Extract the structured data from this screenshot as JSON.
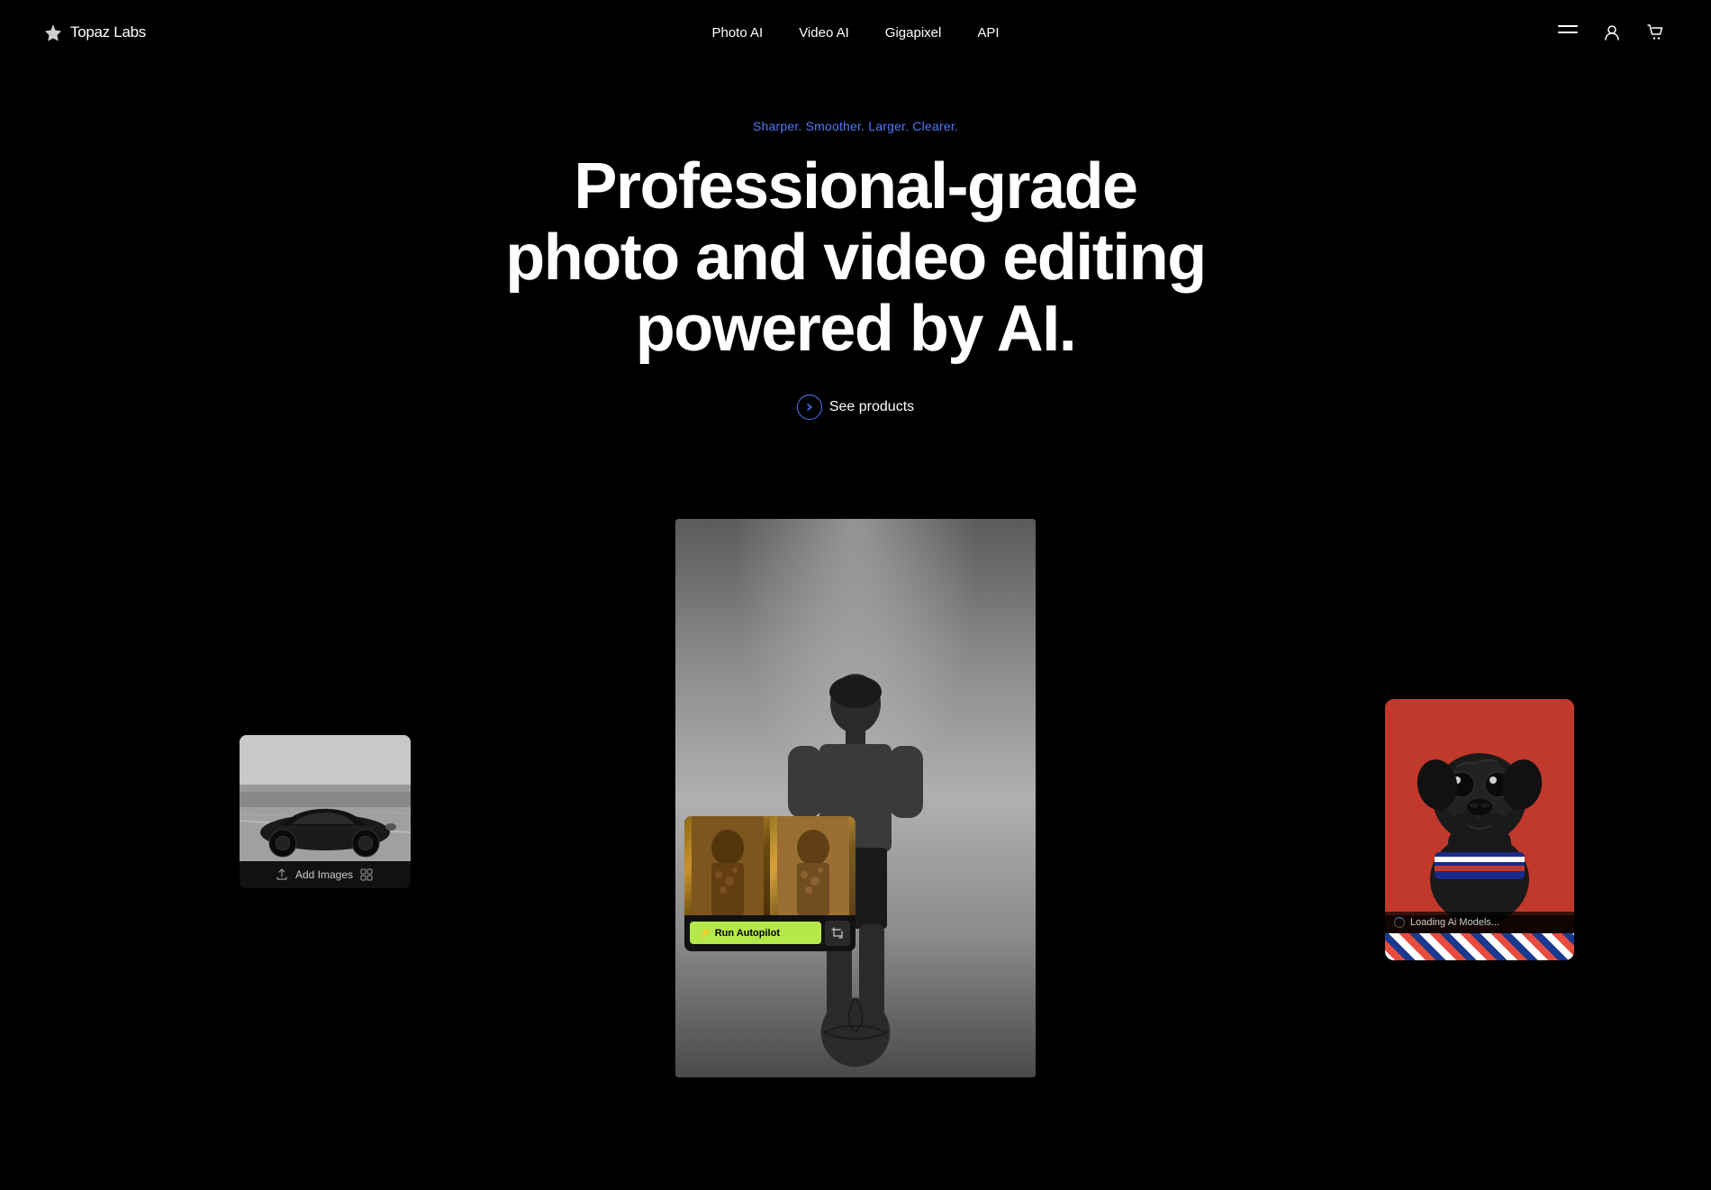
{
  "brand": {
    "name": "Topaz Labs",
    "logo_symbol": "✦"
  },
  "nav": {
    "links": [
      {
        "id": "photo-ai",
        "label": "Photo AI"
      },
      {
        "id": "video-ai",
        "label": "Video AI"
      },
      {
        "id": "gigapixel",
        "label": "Gigapixel"
      },
      {
        "id": "api",
        "label": "API"
      }
    ],
    "icons": {
      "menu": "menu-icon",
      "user": "user-icon",
      "cart": "cart-icon"
    }
  },
  "hero": {
    "tagline": "Sharper. Smoother. Larger. Clearer.",
    "title": "Professional-grade photo and video editing powered by AI.",
    "cta_label": "See products"
  },
  "gallery": {
    "top_panel": {
      "run_autopilot_label": "Run Autopilot",
      "lightning_icon": "⚡",
      "crop_icon": "⊹"
    },
    "left_panel": {
      "add_images_label": "Add Images",
      "upload_icon": "↑",
      "grid_icon": "⊞"
    },
    "right_panel": {
      "loading_label": "Loading Ai Models..."
    }
  },
  "colors": {
    "accent_blue": "#4d7af7",
    "accent_green": "#b5e84a",
    "background": "#000000",
    "panel_bg": "#111111",
    "red_bg": "#c0392b"
  }
}
